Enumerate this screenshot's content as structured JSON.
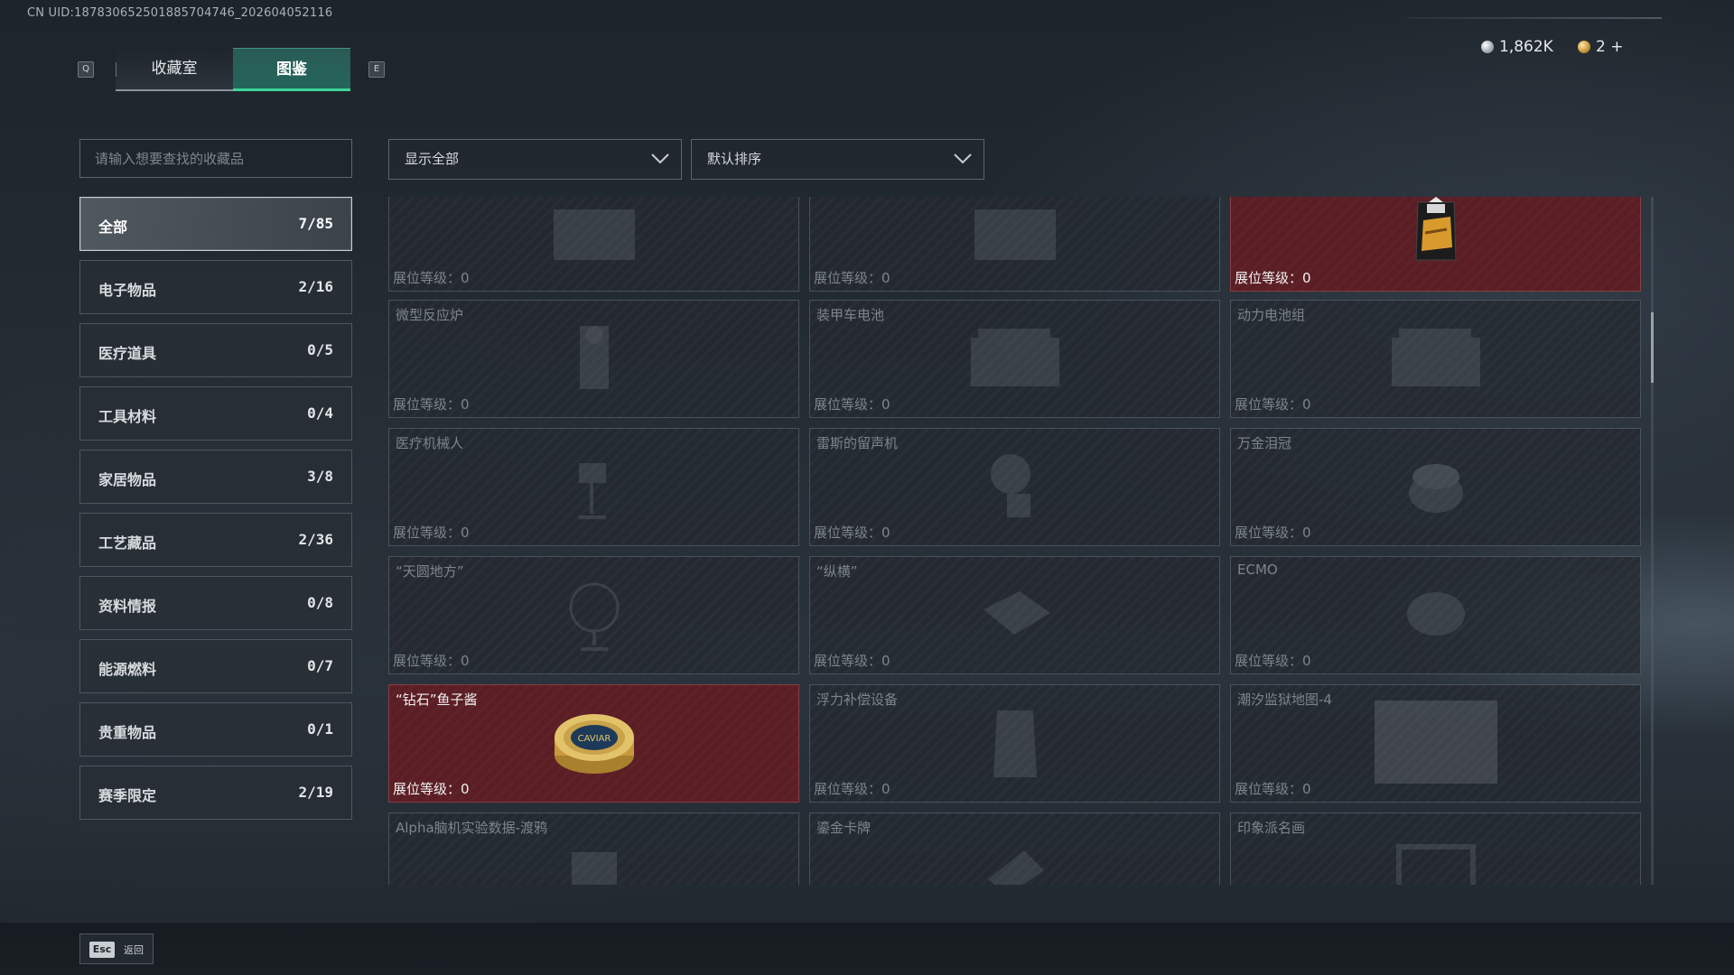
{
  "uid_text": "CN UID:187830652501885704746_202604052116",
  "tabs": {
    "prev_key": "Q",
    "next_key": "E",
    "collection": "收藏室",
    "codex": "图鉴"
  },
  "currency": {
    "coins": "1,862K",
    "tickets": "2 +"
  },
  "search": {
    "placeholder": "请输入想要查找的收藏品"
  },
  "filters": {
    "show": "显示全部",
    "sort": "默认排序"
  },
  "categories": [
    {
      "label": "全部",
      "count": "7/85"
    },
    {
      "label": "电子物品",
      "count": "2/16"
    },
    {
      "label": "医疗道具",
      "count": "0/5"
    },
    {
      "label": "工具材料",
      "count": "0/4"
    },
    {
      "label": "家居物品",
      "count": "3/8"
    },
    {
      "label": "工艺藏品",
      "count": "2/36"
    },
    {
      "label": "资料情报",
      "count": "0/8"
    },
    {
      "label": "能源燃料",
      "count": "0/7"
    },
    {
      "label": "贵重物品",
      "count": "0/1"
    },
    {
      "label": "赛季限定",
      "count": "2/19"
    }
  ],
  "level_label": "展位等级：0",
  "items": [
    {
      "name": "",
      "owned": false,
      "icon": "crate-icon"
    },
    {
      "name": "",
      "owned": false,
      "icon": "device-icon"
    },
    {
      "name": "",
      "owned": true,
      "icon": "coffee-bag-icon"
    },
    {
      "name": "微型反应炉",
      "owned": false,
      "icon": "reactor-icon"
    },
    {
      "name": "装甲车电池",
      "owned": false,
      "icon": "battery-icon"
    },
    {
      "name": "动力电池组",
      "owned": false,
      "icon": "battery-pack-icon"
    },
    {
      "name": "医疗机械人",
      "owned": false,
      "icon": "robot-icon"
    },
    {
      "name": "雷斯的留声机",
      "owned": false,
      "icon": "gramophone-icon"
    },
    {
      "name": "万金泪冠",
      "owned": false,
      "icon": "crown-icon"
    },
    {
      "name": "“天圆地方”",
      "owned": false,
      "icon": "globe-icon"
    },
    {
      "name": "“纵横”",
      "owned": false,
      "icon": "chessboard-icon"
    },
    {
      "name": "ECMO",
      "owned": false,
      "icon": "ecmo-icon"
    },
    {
      "name": "“钻石”鱼子酱",
      "owned": true,
      "icon": "caviar-tin-icon",
      "tin_text": "CAVIAR"
    },
    {
      "name": "浮力补偿设备",
      "owned": false,
      "icon": "vest-icon"
    },
    {
      "name": "潮汐监狱地图-4",
      "owned": false,
      "icon": "map-icon"
    },
    {
      "name": "Alpha脑机实验数据-渡鸦",
      "owned": false,
      "icon": "drive-icon"
    },
    {
      "name": "鎏金卡牌",
      "owned": false,
      "icon": "card-icon"
    },
    {
      "name": "印象派名画",
      "owned": false,
      "icon": "painting-icon"
    }
  ],
  "footer": {
    "esc_key": "Esc",
    "back": "返回"
  }
}
